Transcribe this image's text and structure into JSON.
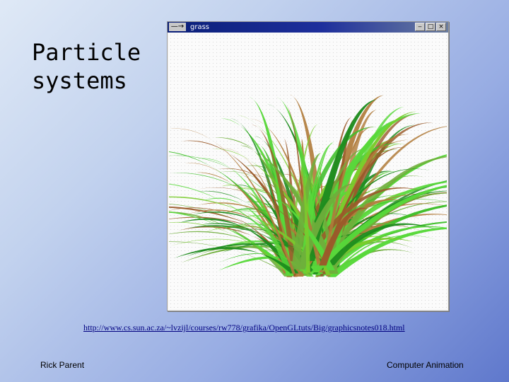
{
  "slide": {
    "title_line1": "Particle",
    "title_line2": "systems",
    "link": "http://www.cs.sun.ac.za/~lvzijl/courses/rw778/grafika/OpenGLtuts/Big/graphicsnotes018.html",
    "author": "Rick Parent",
    "course": "Computer Animation"
  },
  "window": {
    "title": "grass",
    "menu_glyph": "—→",
    "min_glyph": "‒",
    "max_glyph": "□",
    "close_glyph": "×",
    "image_icon": "grass-particle-render-icon"
  },
  "colors": {
    "background_light": "#dfe9f6",
    "background_dark": "#5f78cc",
    "link": "#000080",
    "titlebar": "#0a1f78",
    "grass": [
      "#1e8c1e",
      "#3fbf2a",
      "#7acc2c",
      "#9a5a2a",
      "#b07b3a",
      "#6fae3b",
      "#58d83a"
    ]
  }
}
